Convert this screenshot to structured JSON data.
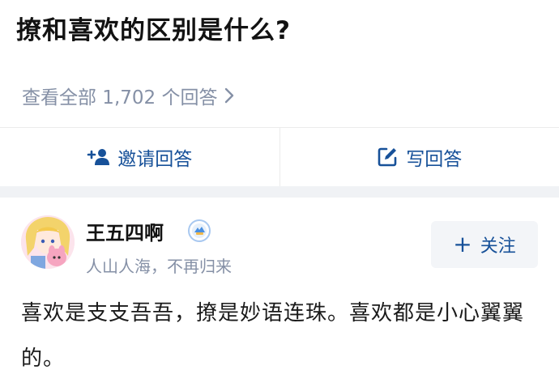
{
  "question": {
    "title": "撩和喜欢的区别是什么?"
  },
  "answers_link": {
    "label": "查看全部 1,702 个回答"
  },
  "actions": {
    "invite_label": "邀请回答",
    "write_label": "写回答"
  },
  "author": {
    "name": "王五四啊",
    "bio": "人山人海，不再归来",
    "follow_label": "关注"
  },
  "answer": {
    "text": "喜欢是支支吾吾，撩是妙语连珠。喜欢都是小心翼翼的。"
  },
  "colors": {
    "link_blue": "#175199",
    "meta_gray": "#8590a6",
    "gap_gray": "#f0f2f5"
  },
  "icons": [
    "chevron-right-icon",
    "invite-user-icon",
    "edit-icon",
    "verified-badge-icon",
    "plus-icon"
  ]
}
